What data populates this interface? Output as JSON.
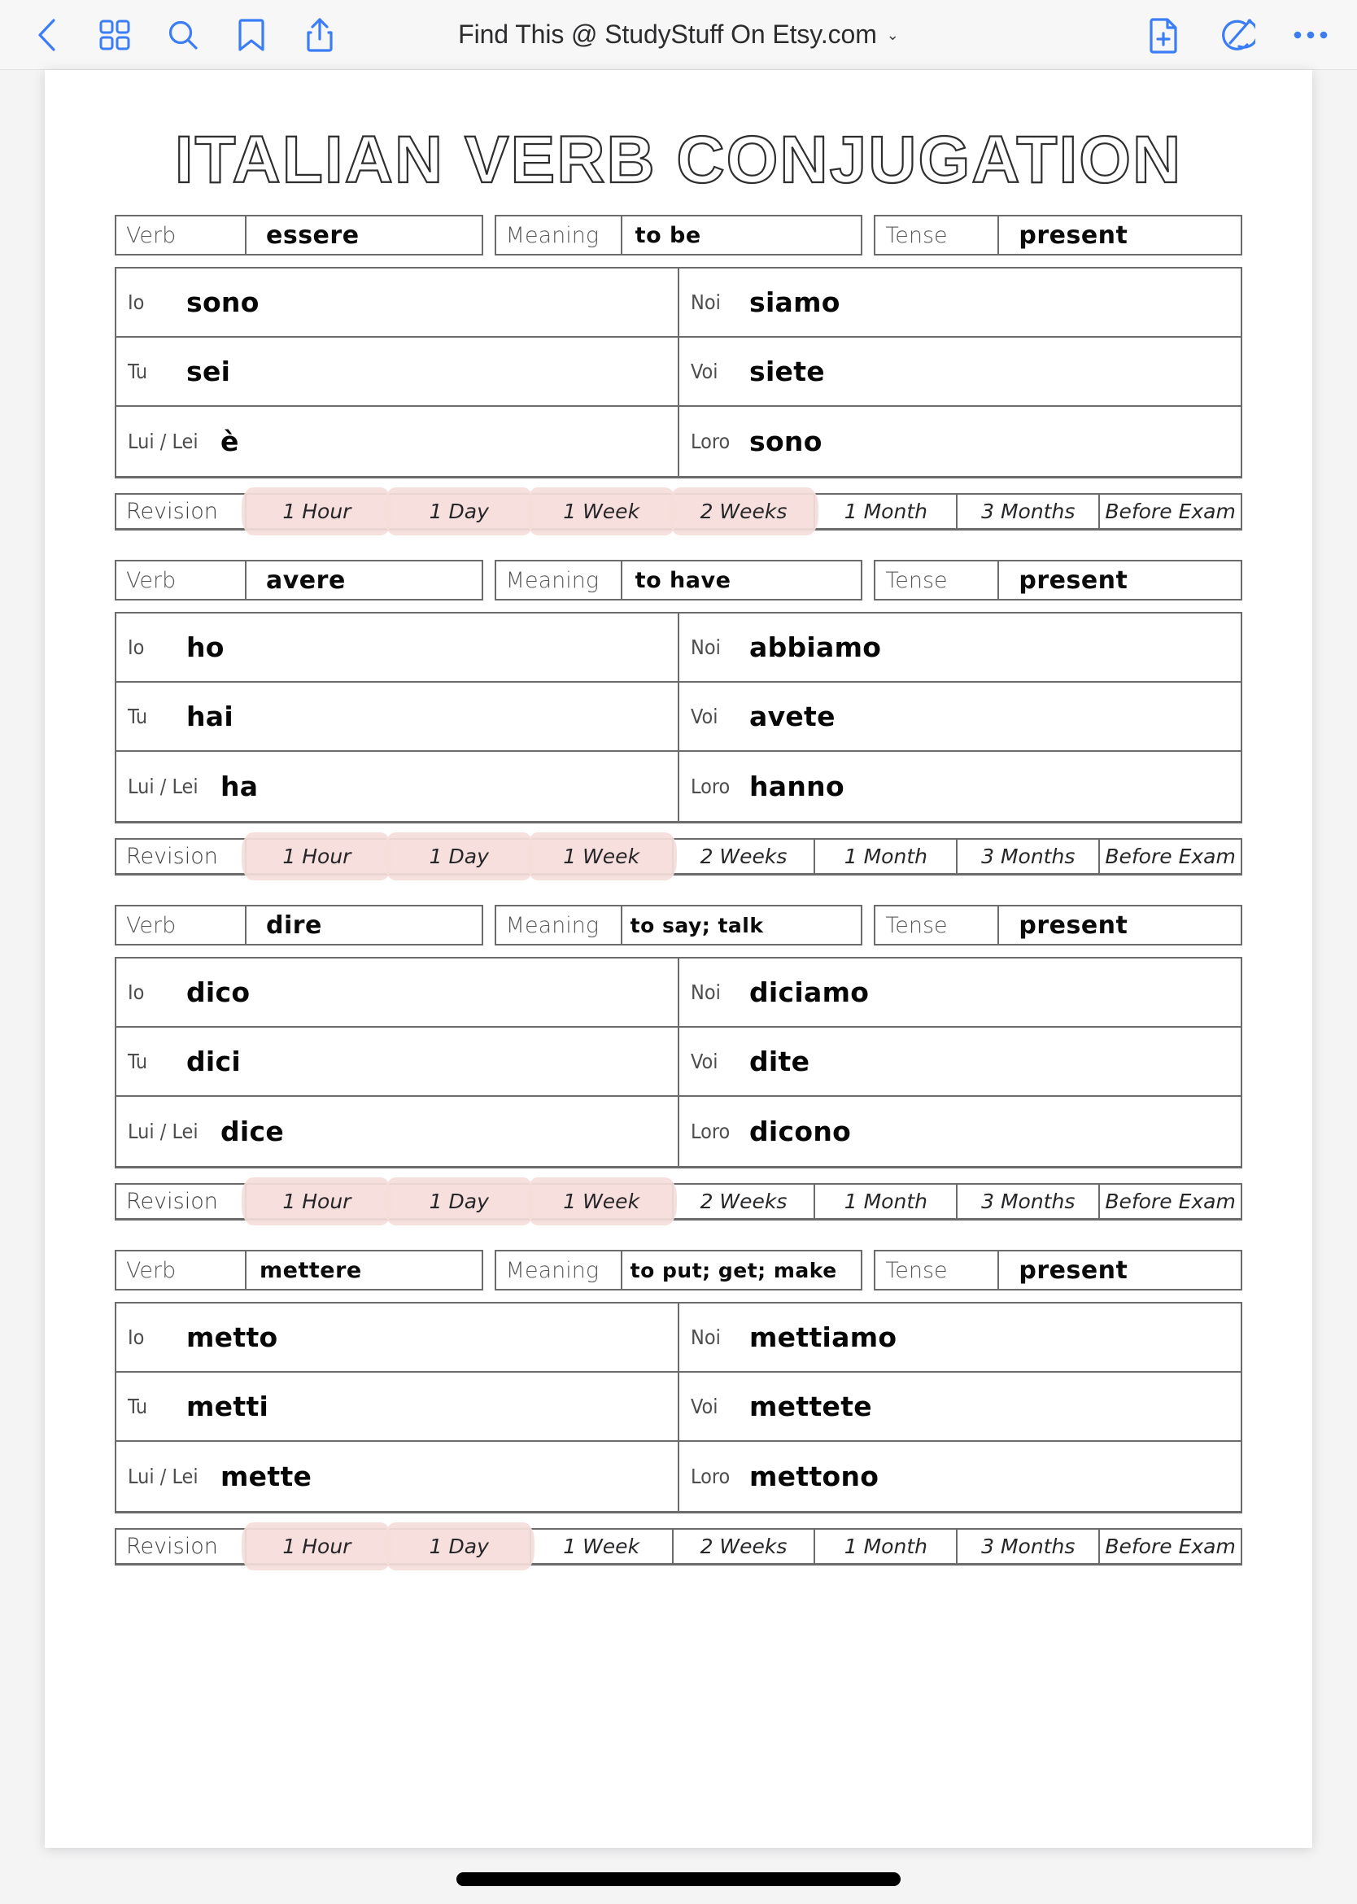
{
  "toolbar": {
    "left_icons": [
      {
        "name": "back-chevron-icon",
        "label": "Back"
      },
      {
        "name": "thumbnails-grid-icon",
        "label": "Page Thumbnails"
      },
      {
        "name": "search-icon",
        "label": "Search"
      },
      {
        "name": "bookmark-icon",
        "label": "Bookmark"
      },
      {
        "name": "share-icon",
        "label": "Share"
      }
    ],
    "right_icons": [
      {
        "name": "add-page-icon",
        "label": "New Page"
      },
      {
        "name": "markup-pen-icon",
        "label": "Markup"
      },
      {
        "name": "more-options-icon",
        "label": "More"
      }
    ],
    "document_title": "Find This @ StudyStuff On Etsy.com",
    "title_chevron": "⌄",
    "accent_color": "#3b7df6"
  },
  "page": {
    "title": "ITALIAN VERB CONJUGATION",
    "labels": {
      "verb": "Verb",
      "meaning": "Meaning",
      "tense": "Tense",
      "revision": "Revision"
    },
    "pronouns": {
      "io": "Io",
      "tu": "Tu",
      "lui_lei": "Lui / Lei",
      "noi": "Noi",
      "voi": "Voi",
      "loro": "Loro"
    },
    "revision_intervals": [
      "1 Hour",
      "1 Day",
      "1 Week",
      "2 Weeks",
      "1 Month",
      "3 Months",
      "Before Exam"
    ],
    "highlight_color": "#f6dedb"
  },
  "verb_blocks": [
    {
      "verb": "essere",
      "meaning": "to be",
      "tense": "present",
      "conjugation": {
        "io": "sono",
        "tu": "sei",
        "lui_lei": "è",
        "noi": "siamo",
        "voi": "siete",
        "loro": "sono"
      },
      "revision_highlighted": [
        true,
        true,
        true,
        true,
        false,
        false,
        false
      ]
    },
    {
      "verb": "avere",
      "meaning": "to have",
      "tense": "present",
      "conjugation": {
        "io": "ho",
        "tu": "hai",
        "lui_lei": "ha",
        "noi": "abbiamo",
        "voi": "avete",
        "loro": "hanno"
      },
      "revision_highlighted": [
        true,
        true,
        true,
        false,
        false,
        false,
        false
      ]
    },
    {
      "verb": "dire",
      "meaning": "to say; talk",
      "tense": "present",
      "conjugation": {
        "io": "dico",
        "tu": "dici",
        "lui_lei": "dice",
        "noi": "diciamo",
        "voi": "dite",
        "loro": "dicono"
      },
      "revision_highlighted": [
        true,
        true,
        true,
        false,
        false,
        false,
        false
      ]
    },
    {
      "verb": "mettere",
      "meaning": "to put; get; make",
      "tense": "present",
      "conjugation": {
        "io": "metto",
        "tu": "metti",
        "lui_lei": "mette",
        "noi": "mettiamo",
        "voi": "mettete",
        "loro": "mettono"
      },
      "revision_highlighted": [
        true,
        true,
        false,
        false,
        false,
        false,
        false
      ]
    }
  ]
}
